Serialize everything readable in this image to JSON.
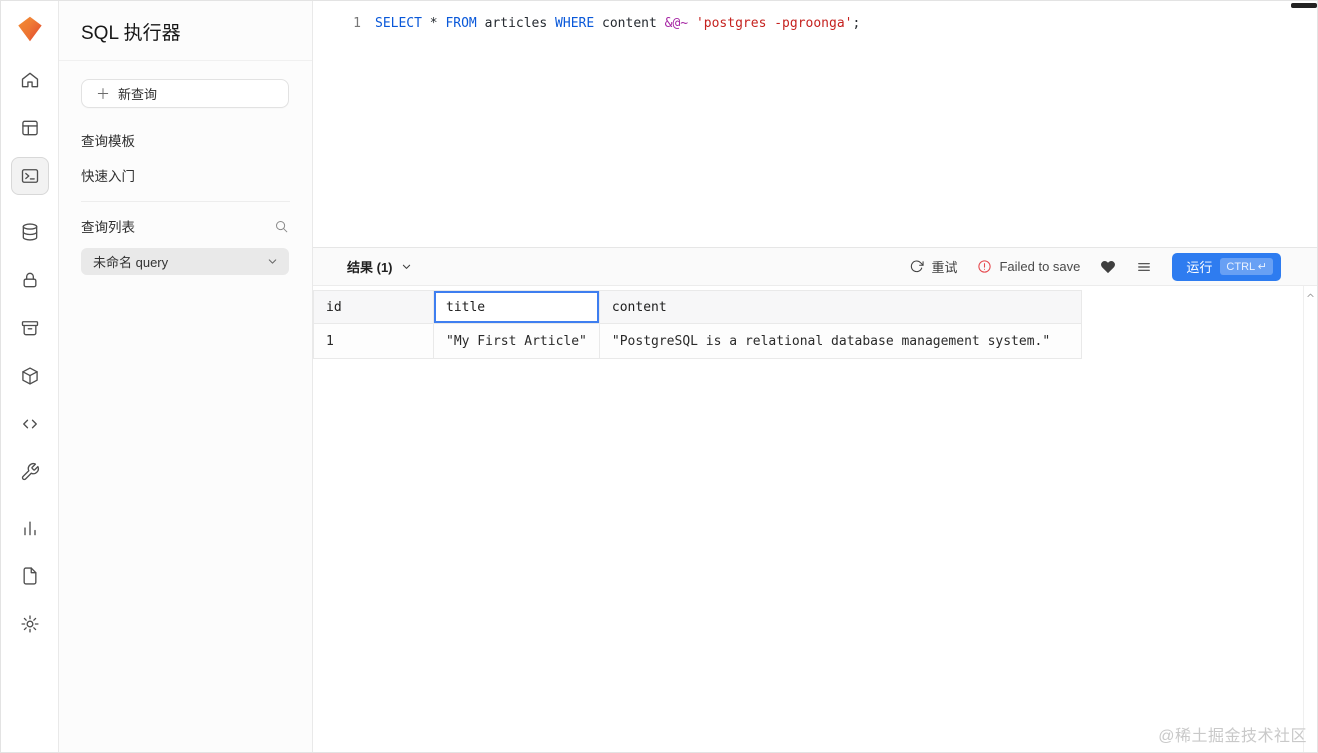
{
  "app": {
    "accent_color": "#2e7cf0",
    "error_color": "#e5484d"
  },
  "rail": {
    "icons": [
      "app-logo",
      "home-icon",
      "table-editor-icon",
      "sql-editor-icon",
      "database-icon",
      "auth-lock-icon",
      "storage-icon",
      "functions-cube-icon",
      "api-code-icon",
      "tools-wrench-icon",
      "reports-chart-icon",
      "logs-file-icon",
      "settings-gear-icon"
    ],
    "active": "sql-editor-icon"
  },
  "sidebar": {
    "title": "SQL 执行器",
    "new_query": "新查询",
    "plus": "＋",
    "links": [
      "查询模板",
      "快速入门"
    ],
    "query_list_label": "查询列表",
    "selected_query": "未命名 query"
  },
  "editor": {
    "line_number": "1",
    "tokens": [
      {
        "text": "SELECT",
        "type": "keyword"
      },
      {
        "text": " * ",
        "type": "plain"
      },
      {
        "text": "FROM",
        "type": "keyword"
      },
      {
        "text": " articles ",
        "type": "plain"
      },
      {
        "text": "WHERE",
        "type": "keyword"
      },
      {
        "text": " content ",
        "type": "plain"
      },
      {
        "text": "&@~",
        "type": "operator"
      },
      {
        "text": " ",
        "type": "plain"
      },
      {
        "text": "'postgres -pgroonga'",
        "type": "string"
      },
      {
        "text": ";",
        "type": "plain"
      }
    ],
    "colors": {
      "keyword": "#0958d9",
      "operator": "#a626a4",
      "string": "#c5221f",
      "plain": "#24292f"
    }
  },
  "results": {
    "label": "结果 (1)",
    "retry": "重试",
    "save_error": "Failed to save",
    "run_label": "运行",
    "run_kbd": "CTRL ↵",
    "table": {
      "columns": [
        "id",
        "title",
        "content"
      ],
      "selected_column": "title",
      "rows": [
        [
          "1",
          "\"My First Article\"",
          "\"PostgreSQL is a relational database management system.\""
        ]
      ]
    }
  },
  "watermark": "@稀土掘金技术社区"
}
